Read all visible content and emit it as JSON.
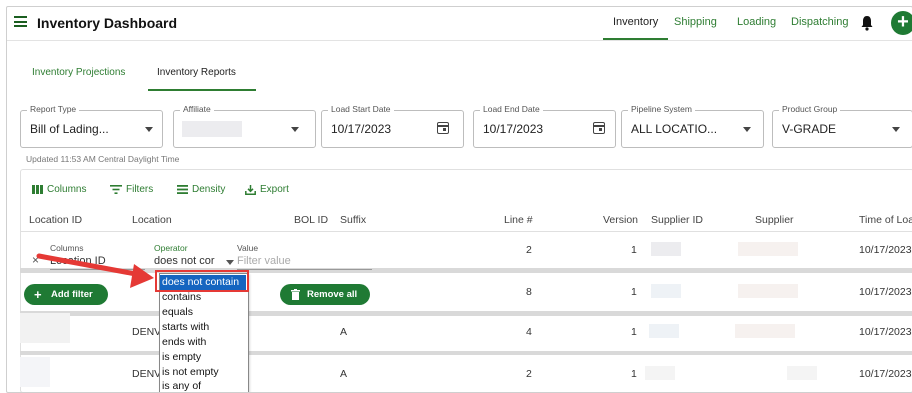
{
  "header": {
    "title": "Inventory Dashboard",
    "nav": [
      "Inventory",
      "Shipping",
      "Loading",
      "Dispatching"
    ]
  },
  "tabs": [
    "Inventory Projections",
    "Inventory Reports"
  ],
  "filters": {
    "report_type": {
      "label": "Report Type",
      "value": "Bill of Lading..."
    },
    "affiliate": {
      "label": "Affiliate",
      "value": ""
    },
    "load_start": {
      "label": "Load Start Date",
      "value": "10/17/2023"
    },
    "load_end": {
      "label": "Load End Date",
      "value": "10/17/2023"
    },
    "pipeline": {
      "label": "Pipeline System",
      "value": "ALL LOCATIO..."
    },
    "product": {
      "label": "Product Group",
      "value": "V-GRADE"
    }
  },
  "updated": "Updated 11:53 AM Central Daylight Time",
  "toolbar": {
    "columns": "Columns",
    "filters": "Filters",
    "density": "Density",
    "export": "Export"
  },
  "grid": {
    "columns": [
      "Location ID",
      "Location",
      "BOL ID",
      "Suffix",
      "Line #",
      "Version",
      "Supplier ID",
      "Supplier",
      "Time of Loa"
    ],
    "rows": [
      {
        "location": "",
        "suffix": "",
        "line": "2",
        "version": "1",
        "time": "10/17/2023"
      },
      {
        "location": "",
        "suffix": "",
        "line": "8",
        "version": "1",
        "time": "10/17/2023"
      },
      {
        "location": "DENV",
        "suffix": "A",
        "line": "4",
        "version": "1",
        "time": "10/17/2023"
      },
      {
        "location": "DENV",
        "suffix": "A",
        "line": "2",
        "version": "1",
        "time": "10/17/2023"
      }
    ]
  },
  "filter_panel": {
    "columns_label": "Columns",
    "operator_label": "Operator",
    "value_label": "Value",
    "column_value": "Location ID",
    "operator_value": "does not cor",
    "value_placeholder": "Filter value",
    "add_filter": "Add filter",
    "remove_all": "Remove all",
    "close_glyph": "×"
  },
  "operator_options": [
    "does not contain",
    "contains",
    "equals",
    "starts with",
    "ends with",
    "is empty",
    "is not empty",
    "is any of"
  ],
  "colors": {
    "brand_green": "#1f7a34",
    "selection_blue": "#1565c0",
    "annotation_red": "#e53935"
  }
}
